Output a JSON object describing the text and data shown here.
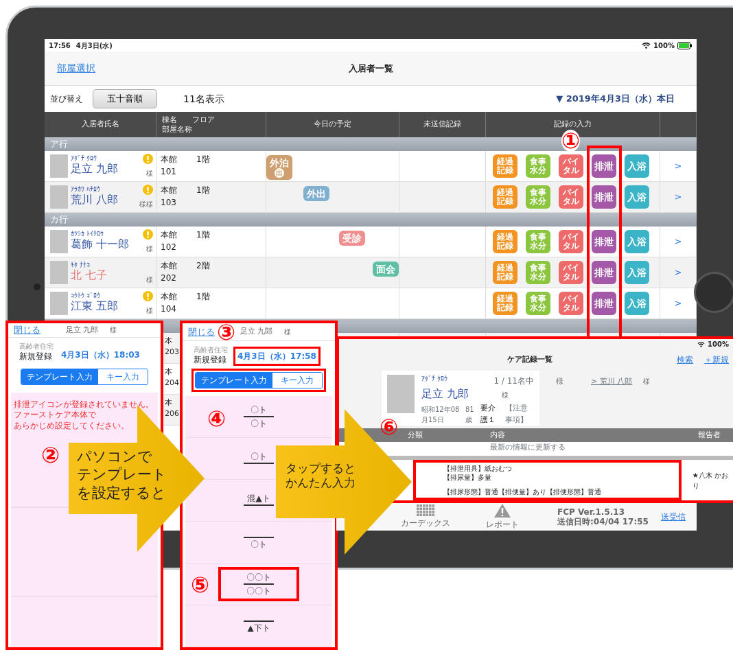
{
  "status_bar": {
    "time": "17:56",
    "date": "4月3日(水)",
    "battery": "100%"
  },
  "nav_bar": {
    "back": "部屋選択",
    "title": "入居者一覧"
  },
  "sort_bar": {
    "label": "並び替え",
    "button": "五十音順",
    "count": "11名表示",
    "date": "▼ 2019年4月3日（水）本日"
  },
  "table": {
    "columns": [
      "入居者氏名",
      [
        "棟名　　フロア",
        "部屋名称"
      ],
      "今日の予定",
      "未送信記録",
      "記録の入力"
    ],
    "groups": [
      {
        "label": "ア行",
        "rows": [
          {
            "kana": "ｱﾀﾞﾁ ｸﾛｳ",
            "name": "足立 九郎",
            "honorific": "様",
            "color": "#3a5ba9",
            "alert": true,
            "building": "本館",
            "floor": "1階",
            "room": "101",
            "schedule": {
              "label": "外泊",
              "sub": "出",
              "color": "#cf9f6f",
              "level": 0.1
            },
            "records": [
              {
                "label": "経過記録",
                "color": "#f39422"
              },
              {
                "label": "食事水分",
                "color": "#8cc63f"
              },
              {
                "label": "バイタル",
                "color": "#ef6b6b"
              },
              {
                "label": "排泄",
                "color": "#a459a8"
              },
              {
                "label": "入浴",
                "color": "#3bb4c8"
              }
            ],
            "chevron": ">"
          },
          {
            "kana": "ｱﾗｶﾜ ﾊﾁﾛｳ",
            "name": "荒川 八郎",
            "honorific": "様様",
            "color": "#3a5ba9",
            "alert": true,
            "building": "本館",
            "floor": "1階",
            "room": "103",
            "schedule": {
              "label": "外出",
              "color": "#7fb0d0",
              "level": 0.38
            },
            "records": [
              {
                "label": "経過記録",
                "color": "#f39422"
              },
              {
                "label": "食事水分",
                "color": "#8cc63f"
              },
              {
                "label": "バイタル",
                "color": "#ef6b6b"
              },
              {
                "label": "排泄",
                "color": "#a459a8"
              },
              {
                "label": "入浴",
                "color": "#3bb4c8"
              }
            ],
            "chevron": ">"
          }
        ]
      },
      {
        "label": "カ行",
        "rows": [
          {
            "kana": "ｶﾂｼｶ ﾄｲﾁﾛｳ",
            "name": "葛飾 十一郎",
            "honorific": "様",
            "color": "#3a5ba9",
            "alert": true,
            "building": "本館",
            "floor": "1階",
            "room": "102",
            "schedule": {
              "label": "受診",
              "color": "#ef8f8f",
              "level": 0.65
            },
            "records": [
              {
                "label": "経過記録",
                "color": "#f39422"
              },
              {
                "label": "食事水分",
                "color": "#8cc63f"
              },
              {
                "label": "バイタル",
                "color": "#ef6b6b"
              },
              {
                "label": "排泄",
                "color": "#a459a8"
              },
              {
                "label": "入浴",
                "color": "#3bb4c8"
              }
            ],
            "chevron": ">"
          },
          {
            "kana": "ｷﾀ ﾅﾅｺ",
            "name": "北 七子",
            "honorific": "様",
            "color": "#e57373",
            "alert": false,
            "building": "本館",
            "floor": "2階",
            "room": "202",
            "schedule": {
              "label": "面会",
              "color": "#5fbfa5",
              "level": 0.9
            },
            "records": [
              {
                "label": "経過記録",
                "color": "#f39422"
              },
              {
                "label": "食事水分",
                "color": "#8cc63f"
              },
              {
                "label": "バイタル",
                "color": "#ef6b6b"
              },
              {
                "label": "排泄",
                "color": "#a459a8"
              },
              {
                "label": "入浴",
                "color": "#3bb4c8"
              }
            ],
            "chevron": ">"
          },
          {
            "kana": "ｺｳﾄｳ ｺﾞﾛｳ",
            "name": "江東 五郎",
            "honorific": "様",
            "color": "#3a5ba9",
            "alert": true,
            "building": "本館",
            "floor": "1階",
            "room": "104",
            "records": [
              {
                "label": "経過記録",
                "color": "#f39422"
              },
              {
                "label": "食事水分",
                "color": "#8cc63f"
              },
              {
                "label": "バイタル",
                "color": "#ef6b6b"
              },
              {
                "label": "排泄",
                "color": "#a459a8"
              },
              {
                "label": "入浴",
                "color": "#3bb4c8"
              }
            ],
            "chevron": ">"
          }
        ]
      },
      {
        "rows": [
          {
            "building": "本",
            "room": "203"
          },
          {
            "building": "本",
            "room": "204"
          },
          {
            "building": "本",
            "room": "206"
          }
        ]
      }
    ]
  },
  "template_panels": [
    {
      "close": "閉じる",
      "name": "足立 九郎",
      "honorific": "様",
      "facility": "高齢者住宅",
      "action": "新規登録",
      "date": "4月3日（水）18:03",
      "date_highlighted": false,
      "segments": [
        {
          "label": "テンプレート入力",
          "selected": true
        },
        {
          "label": "キー入力",
          "selected": false
        }
      ],
      "segments_highlighted": false,
      "message_lines": [
        "排泄アイコンが登録されていません。",
        "ファーストケア本体で",
        "あらかじめ設定してください。"
      ]
    },
    {
      "close": "閉じる",
      "name": "足立 九郎",
      "honorific": "様",
      "facility": "高齢者住宅",
      "action": "新規登録",
      "date": "4月3日（水）17:58",
      "date_highlighted": true,
      "segments": [
        {
          "label": "テンプレート入力",
          "selected": true
        },
        {
          "label": "キー入力",
          "selected": false
        }
      ],
      "segments_highlighted": true,
      "items": [
        {
          "top": "〇ト",
          "bottom": "〇ト",
          "highlighted": false
        },
        {
          "top": "〇ト",
          "highlighted": false
        },
        {
          "top": "混▲ト",
          "highlighted": false
        },
        {
          "bottom": "〇ト",
          "highlighted": false
        },
        {
          "top": "〇〇ト",
          "bottom": "〇〇ト",
          "highlighted": true
        },
        {
          "bottom": "▲下ト",
          "highlighted": false
        }
      ]
    }
  ],
  "care_panel": {
    "battery": "100%",
    "title": "ケア記録一覧",
    "links": [
      "検索",
      "＋新規"
    ],
    "resident": {
      "kana": "ｱﾀﾞﾁ ｸﾛｳ",
      "name": "足立 九郎",
      "honorific": "様",
      "position": "1 / 11名中",
      "birth": "昭和12年08月15日",
      "age": "81歳",
      "care_level": "要介護１",
      "notes": "【注意事項】"
    },
    "next": {
      "honorific": "様",
      "label": "> 荒川 八郎",
      "suffix": "様"
    },
    "columns": [
      "分類",
      "内容",
      "報告者"
    ],
    "refresh": "最新の情報に更新する",
    "entries": [
      {
        "paragraphs": [
          [
            "【排泄用具】紙おむつ",
            "【排尿量】多量"
          ],
          [
            "【排尿形態】普通【排便量】あり【排便形態】普通"
          ]
        ],
        "reporter": "★八木 かおり",
        "highlighted": true
      }
    ]
  },
  "bottom_bar": {
    "items": [
      {
        "label": "カーデックス",
        "kind": "grid"
      },
      {
        "label": "レポート",
        "kind": "warning"
      }
    ],
    "version": "FCP Ver.1.5.13",
    "sent": "送信日時:04/04 17:55",
    "sync": "送受信"
  },
  "callouts": [
    {
      "lines": [
        "パソコンで",
        "テンプレート",
        "を設定すると"
      ]
    },
    {
      "lines": [
        "タップすると",
        "かんたん入力"
      ]
    }
  ],
  "markers": [
    "①",
    "②",
    "③",
    "④",
    "⑤",
    "⑥"
  ]
}
